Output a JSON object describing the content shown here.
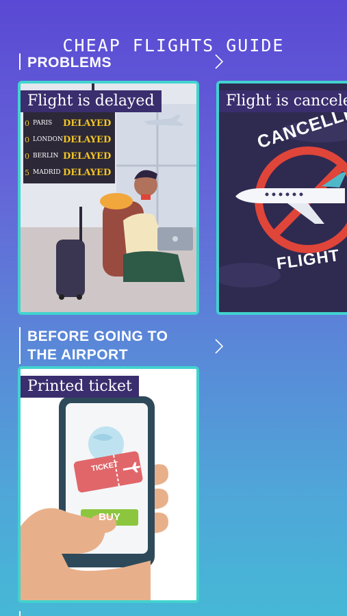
{
  "app": {
    "title": "CHEAP FLIGHTS GUIDE"
  },
  "sections": [
    {
      "title_lines": [
        "PROBLEMS"
      ],
      "cards": [
        {
          "label": "Flight is delayed",
          "board": [
            {
              "num": "0",
              "city": "PARIS",
              "status": "DELAYED"
            },
            {
              "num": "0",
              "city": "LONDON",
              "status": "DELAYED"
            },
            {
              "num": "0",
              "city": "BERLIN",
              "status": "DELAYED"
            },
            {
              "num": "5",
              "city": "MADRID",
              "status": "DELAYED"
            }
          ]
        },
        {
          "label": "Flight is cancele",
          "stamp_top": "CANCELLED",
          "stamp_bottom": "FLIGHT"
        }
      ]
    },
    {
      "title_lines": [
        "BEFORE GOING TO",
        "THE AIRPORT"
      ],
      "cards": [
        {
          "label": "Printed ticket",
          "ticket_text": "TICKET",
          "buy_text": "BUY"
        }
      ]
    }
  ],
  "colors": {
    "accent_border": "#41d3cf",
    "label_bg": "#3a2e6e",
    "delayed": "#f3c623"
  }
}
